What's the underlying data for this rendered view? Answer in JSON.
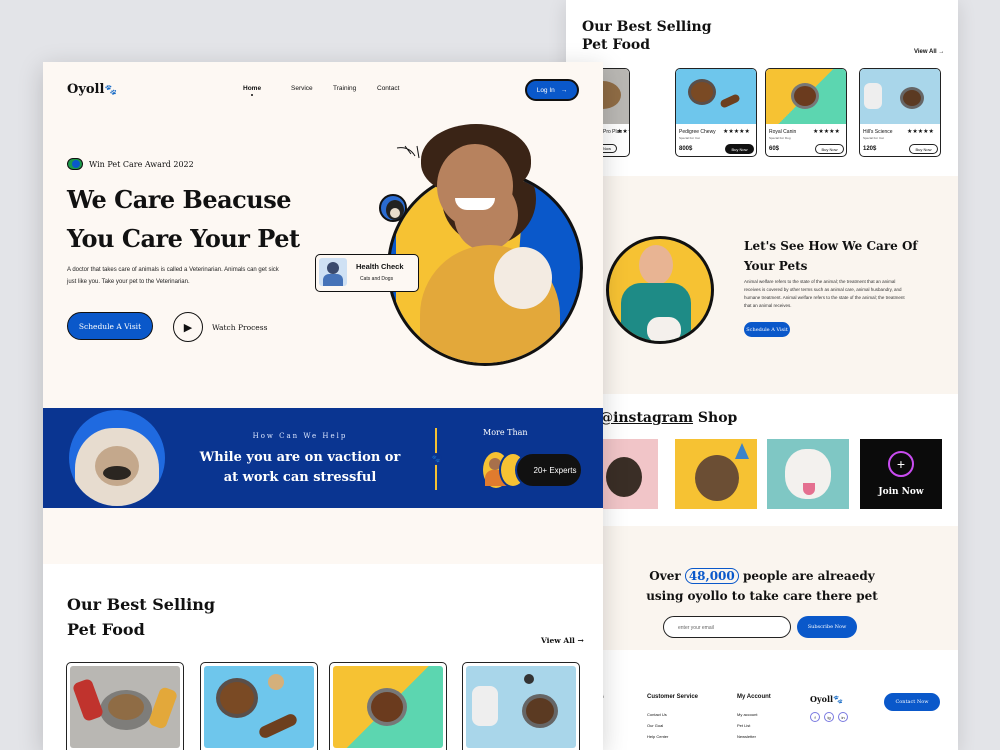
{
  "brand": "Oyoll",
  "nav": {
    "home": "Home",
    "service": "Service",
    "training": "Training",
    "contact": "Contact",
    "login": "Log In"
  },
  "hero": {
    "award": "Win Pet Care Award 2022",
    "title_line1": "We Care Beacuse",
    "title_line2": "You Care Your Pet",
    "desc": "A doctor that takes care of animals is called a Veterinarian. Animals can get sick just like you. Take your pet to the Veterinarian.",
    "cta": "Schedule A Visit",
    "watch": "Watch Process",
    "health_title": "Health Check",
    "health_sub": "Cats and Dogs"
  },
  "banner": {
    "kicker": "How Can We Help",
    "title_line1": "While you are on vaction or",
    "title_line2": "at work can stressful",
    "more": "More Than",
    "experts": "20+ Experts"
  },
  "best": {
    "title_line1": "Our Best Selling",
    "title_line2": "Pet Food",
    "view_all": "View All",
    "products": [
      {
        "name": "Pro Plan",
        "sub": "",
        "price": "",
        "btn": "Buy Now",
        "stars": "★★★★★"
      },
      {
        "name": "Pedigree Chewy",
        "sub": "Special For Cat",
        "price": "800$",
        "btn": "Buy Now",
        "stars": "★★★★★"
      },
      {
        "name": "Royal Canin",
        "sub": "Special For Dog",
        "price": "60$",
        "btn": "Buy Now",
        "stars": "★★★★★"
      },
      {
        "name": "Hill's Science",
        "sub": "Special For Cat",
        "price": "120$",
        "btn": "Buy Now",
        "stars": "★★★★★"
      }
    ]
  },
  "care": {
    "title_line1": "Let's See How We Care Of",
    "title_line2": "Your Pets",
    "text": "Animal welfare refers to the state of the animal; the treatment that an animal receives is covered by other terms such as animal care, animal husbandry, and humane treatment. Animal welfare refers to the state of the animal; the treatment that an animal receives.",
    "cta": "Schedule A Visit"
  },
  "instagram": {
    "prefix": "n ",
    "handle": "@instagram",
    "suffix": " Shop",
    "join": "Join Now"
  },
  "over": {
    "pre": "Over ",
    "count": "48,000",
    "post": " people are alreaedy",
    "line2": "using oyollo to take care there pet",
    "placeholder": "enter your email",
    "subscribe": "Subscribe Now"
  },
  "footer": {
    "col0": "Us",
    "col0_items": [
      "icy",
      "icy"
    ],
    "col1": "Customer Service",
    "col1_items": [
      "Contact Us",
      "Our Goal",
      "Help Center"
    ],
    "col2": "My Account",
    "col2_items": [
      "My account",
      "Pet List",
      "Newsletter"
    ],
    "brand": "Oyoll",
    "contact": "Contact Now",
    "socials": [
      "f",
      "ig",
      "in"
    ]
  },
  "colors": {
    "blue": "#0a58ca",
    "green": "#1c9a4a",
    "navy": "#0a3591",
    "yellow": "#f6c233",
    "cream": "#fdf8f3"
  }
}
